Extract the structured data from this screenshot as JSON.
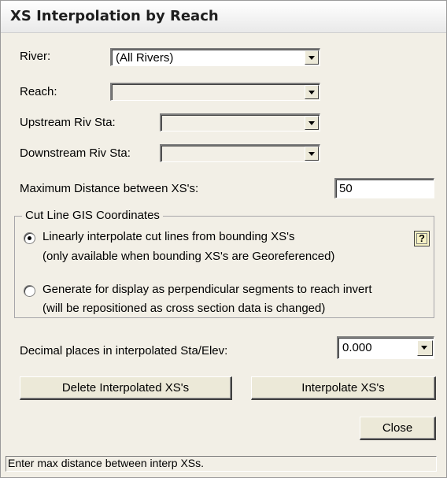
{
  "window": {
    "title": "XS Interpolation by Reach"
  },
  "river": {
    "label": "River:",
    "value": "(All Rivers)"
  },
  "reach": {
    "label": "Reach:",
    "value": ""
  },
  "upstream": {
    "label": "Upstream Riv Sta:",
    "value": ""
  },
  "downstream": {
    "label": "Downstream Riv Sta:",
    "value": ""
  },
  "max_distance": {
    "label": "Maximum  Distance  between XS's:",
    "value": "50"
  },
  "cutline_group": {
    "label": "Cut Line GIS Coordinates",
    "option1": {
      "line1": "Linearly interpolate cut lines from bounding XS's",
      "line2": "(only available when bounding XS's are Georeferenced)",
      "selected": true
    },
    "option2": {
      "line1": "Generate for display as perpendicular segments to reach invert",
      "line2": "(will be repositioned as cross section data is changed)",
      "selected": false
    },
    "help_label": "?"
  },
  "decimal": {
    "label": "Decimal places in interpolated Sta/Elev:",
    "value": "0.000"
  },
  "buttons": {
    "delete": "Delete Interpolated  XS's",
    "interpolate": "Interpolate XS's",
    "close": "Close"
  },
  "status": "Enter max distance between interp XSs."
}
